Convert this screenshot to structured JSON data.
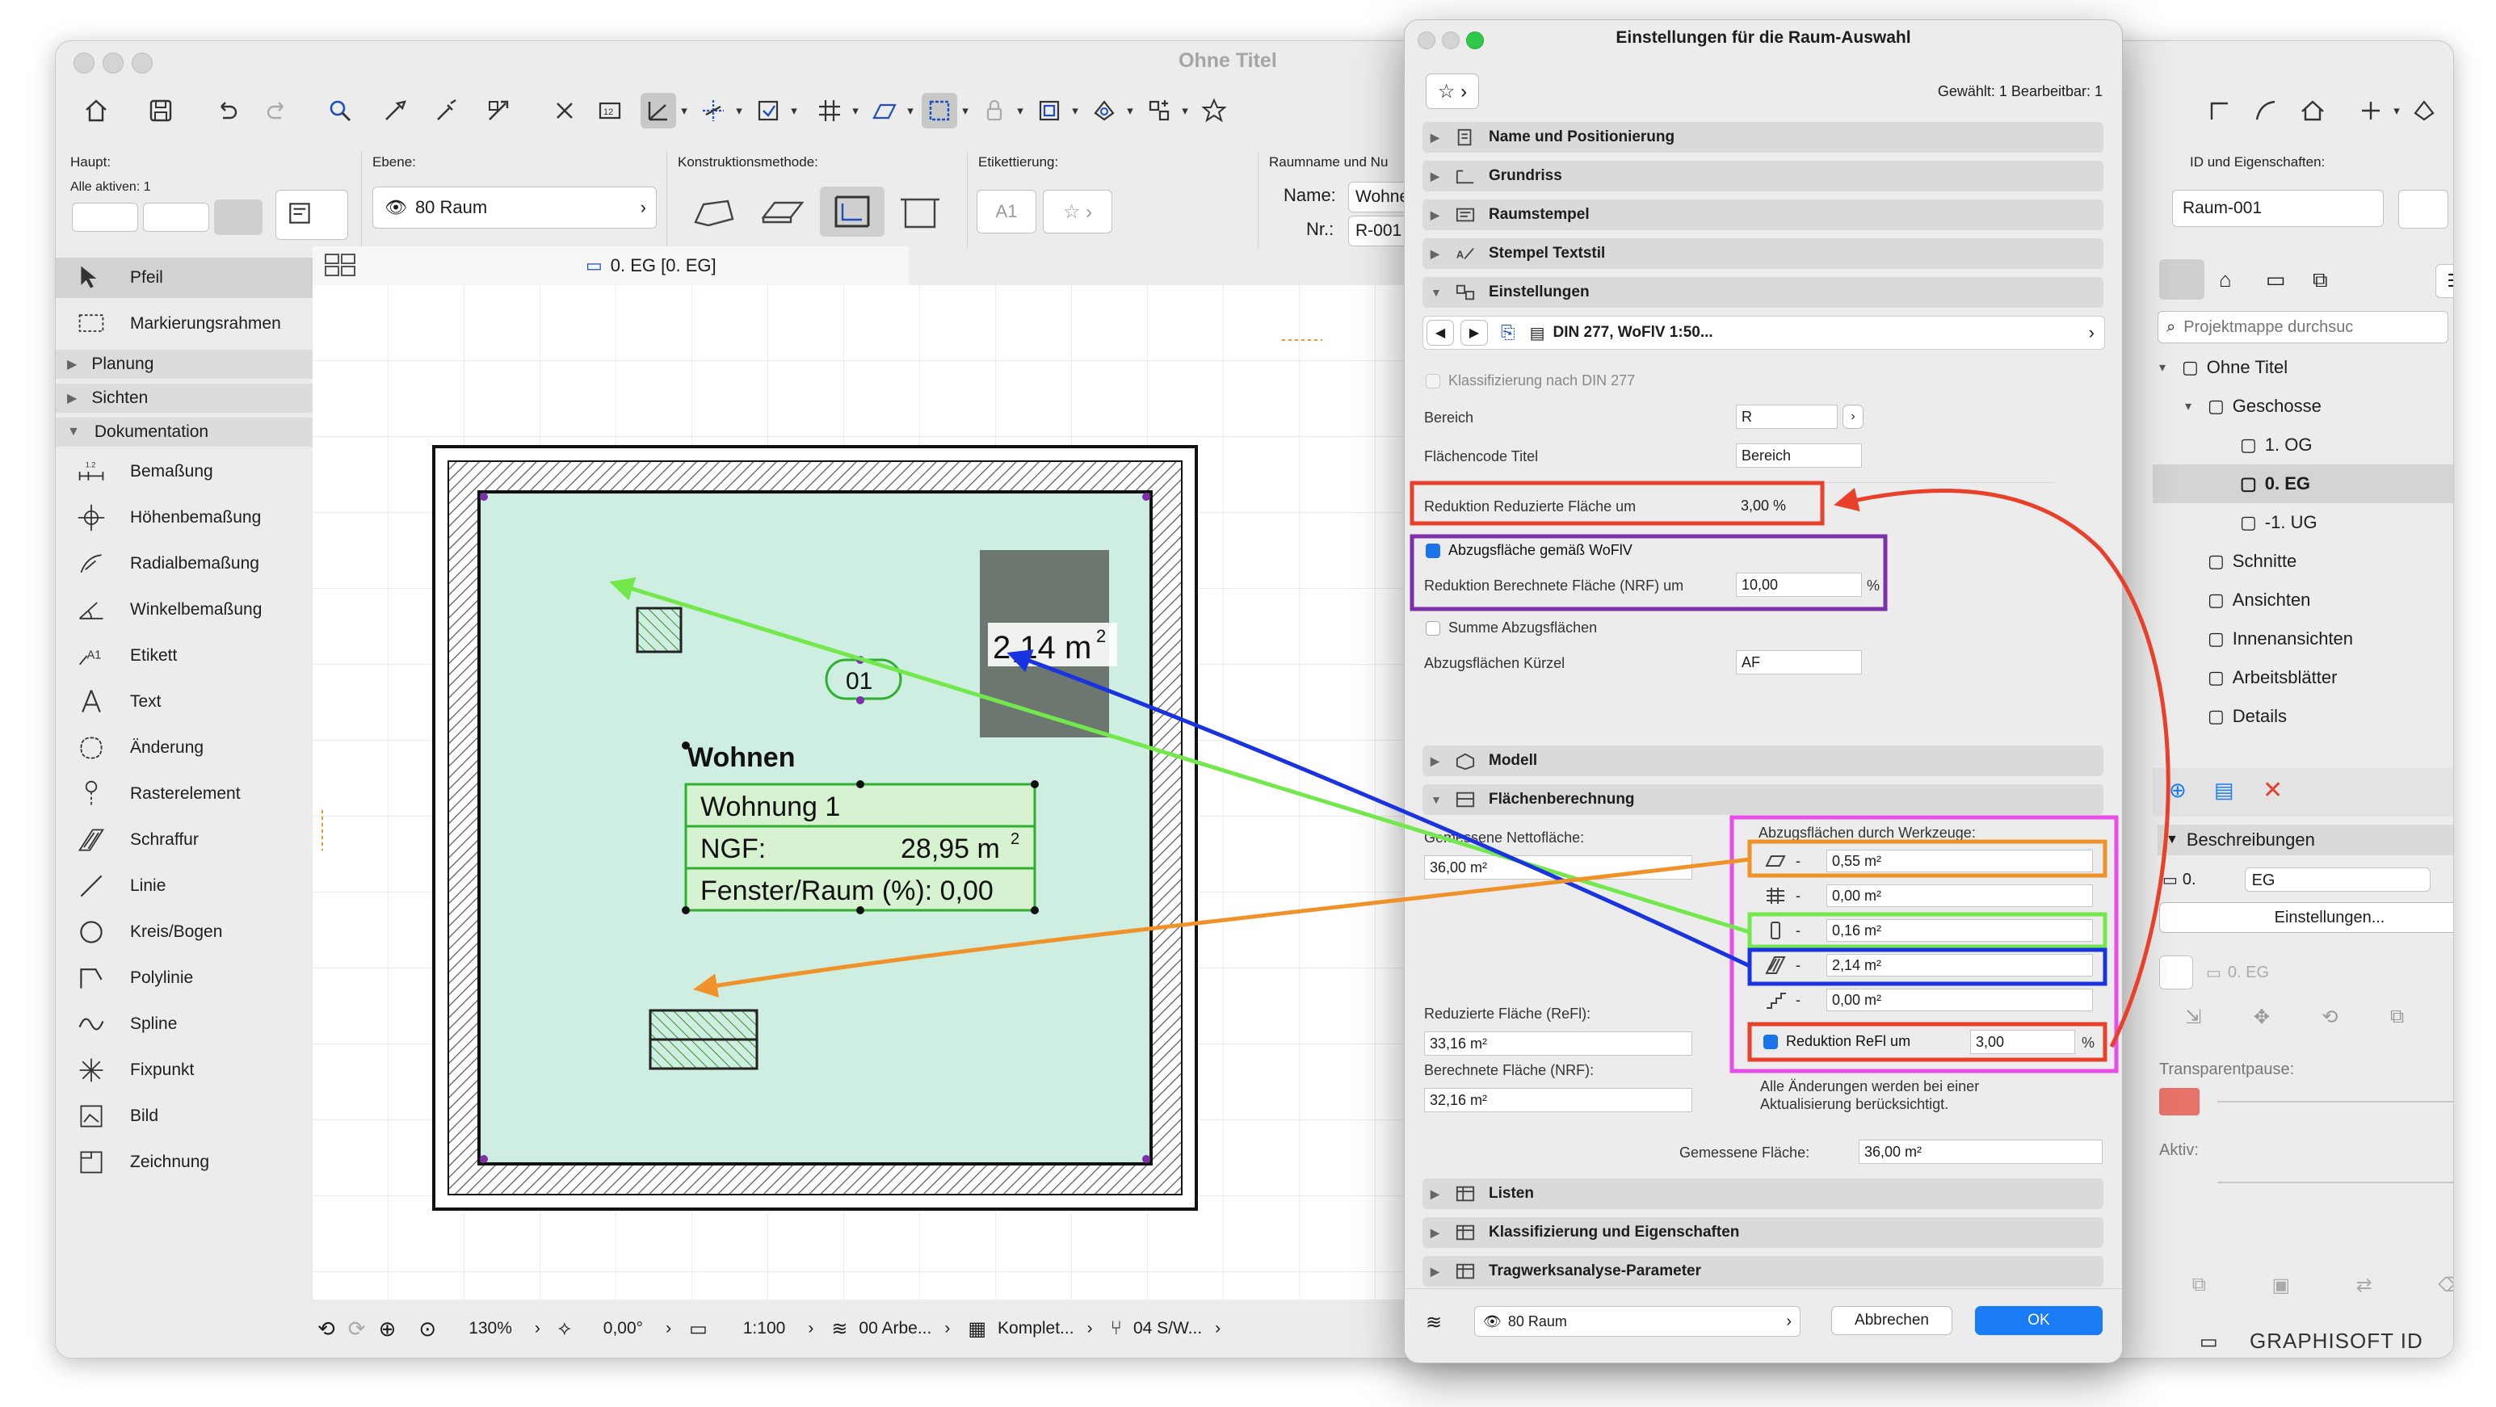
{
  "app": {
    "window_title": "Ohne Titel",
    "dialog_title": "Einstellungen für die Raum-Auswahl"
  },
  "toolbar": {
    "haupt_label": "Haupt:",
    "alle_aktiven": "Alle aktiven: 1",
    "ebene_label": "Ebene:",
    "ebene_value": "80 Raum",
    "konstruktion_label": "Konstruktionsmethode:",
    "etikett_label": "Etikettierung:",
    "etikett_a1": "A1",
    "raumname_label": "Raumname und Nu",
    "name_label": "Name:",
    "name_value": "Wohne",
    "nr_label": "Nr.:",
    "nr_value": "R-001",
    "id_label": "ID und Eigenschaften:",
    "id_value": "Raum-001"
  },
  "view_tab": {
    "label": "0. EG [0. EG]"
  },
  "toolbox": {
    "items_top": [
      {
        "label": "Pfeil"
      },
      {
        "label": "Markierungsrahmen"
      }
    ],
    "sections": [
      {
        "label": "Planung"
      },
      {
        "label": "Sichten"
      },
      {
        "label": "Dokumentation"
      }
    ],
    "doc_items": [
      {
        "label": "Bemaßung"
      },
      {
        "label": "Höhenbemaßung"
      },
      {
        "label": "Radialbemaßung"
      },
      {
        "label": "Winkelbemaßung"
      },
      {
        "label": "Etikett"
      },
      {
        "label": "Text"
      },
      {
        "label": "Änderung"
      },
      {
        "label": "Rasterelement"
      },
      {
        "label": "Schraffur"
      },
      {
        "label": "Linie"
      },
      {
        "label": "Kreis/Bogen"
      },
      {
        "label": "Polylinie"
      },
      {
        "label": "Spline"
      },
      {
        "label": "Fixpunkt"
      },
      {
        "label": "Bild"
      },
      {
        "label": "Zeichnung"
      }
    ]
  },
  "drawing": {
    "area_label": "2,14 m",
    "area_sup": "2",
    "marker": "01",
    "room_name": "Wohnen",
    "stamp_rows": [
      "Wohnung 1",
      "NGF:",
      "Fenster/Raum (%): 0,00"
    ],
    "ngf_value": "28,95 m",
    "ngf_sup": "2"
  },
  "statusbar": {
    "zoom": "130%",
    "angle": "0,00°",
    "scale": "1:100",
    "layer": "00 Arbe...",
    "model": "Komplet...",
    "pen": "04 S/W..."
  },
  "navigator": {
    "search_placeholder": "Projektmappe durchsuc",
    "tree": [
      {
        "label": "Ohne Titel",
        "level": 0
      },
      {
        "label": "Geschosse",
        "level": 1
      },
      {
        "label": "1. OG",
        "level": 2
      },
      {
        "label": "0. EG",
        "level": 2,
        "selected": true
      },
      {
        "label": "-1. UG",
        "level": 2
      },
      {
        "label": "Schnitte",
        "level": 1
      },
      {
        "label": "Ansichten",
        "level": 1
      },
      {
        "label": "Innenansichten",
        "level": 1
      },
      {
        "label": "Arbeitsblätter",
        "level": 1
      },
      {
        "label": "Details",
        "level": 1
      }
    ],
    "beschreibungen": "Beschreibungen",
    "geschoss_row_num": "0.",
    "geschoss_row_name": "EG",
    "einstellungen_btn": "Einstellungen...",
    "selected_view": "0. EG",
    "transparent_label": "Transparentpause:",
    "aktiv_label": "Aktiv:",
    "brand": "GRAPHISOFT ID"
  },
  "dialog": {
    "gewaehlt": "Gewählt: 1 Bearbeitbar: 1",
    "sections_top": [
      {
        "label": "Name und Positionierung",
        "open": false
      },
      {
        "label": "Grundriss",
        "open": false
      },
      {
        "label": "Raumstempel",
        "open": false
      },
      {
        "label": "Stempel Textstil",
        "open": false
      },
      {
        "label": "Einstellungen",
        "open": true
      }
    ],
    "din_value": "DIN 277, WoFlV 1:50...",
    "klassifizierung_label": "Klassifizierung nach DIN 277",
    "bereich_label": "Bereich",
    "bereich_value": "R",
    "flaechencode_label": "Flächencode Titel",
    "flaechencode_value": "Bereich",
    "reduktion_label": "Reduktion Reduzierte Fläche um",
    "reduktion_value": "3,00 %",
    "abzug_wofiv_label": "Abzugsfläche gemäß WoFlV",
    "red_nrf_label": "Reduktion Berechnete Fläche (NRF) um",
    "red_nrf_value": "10,00",
    "red_nrf_unit": "%",
    "summe_label": "Summe Abzugsflächen",
    "kuerzel_label": "Abzugsflächen Kürzel",
    "kuerzel_value": "AF",
    "modell_label": "Modell",
    "flaechenberechnung_label": "Flächenberechnung",
    "gemessene_netto_label": "Gemessene Nettofläche:",
    "gemessene_netto_value": "36,00 m²",
    "abzug_werkzeuge_label": "Abzugsflächen durch Werkzeuge:",
    "abzug_rows": [
      {
        "icon": "slab-icon",
        "value": "0,55 m²"
      },
      {
        "icon": "grid-icon",
        "value": "0,00 m²"
      },
      {
        "icon": "column-icon",
        "value": "0,16 m²"
      },
      {
        "icon": "fill-icon",
        "value": "2,14 m²"
      },
      {
        "icon": "stair-icon",
        "value": "0,00 m²"
      }
    ],
    "dash": "-",
    "reduktion_refl_label": "Reduktion ReFl um",
    "reduktion_refl_value": "3,00",
    "reduktion_refl_unit": "%",
    "reduzierte_label": "Reduzierte Fläche (ReFl):",
    "reduzierte_value": "33,16 m²",
    "berechnete_label": "Berechnete Fläche (NRF):",
    "berechnete_value": "32,16 m²",
    "hinweis_line1": "Alle Änderungen werden bei einer",
    "hinweis_line2": "Aktualisierung berücksichtigt.",
    "gemessene_flaeche_label": "Gemessene Fläche:",
    "gemessene_flaeche_value": "36,00 m²",
    "sections_bottom": [
      {
        "label": "Listen"
      },
      {
        "label": "Klassifizierung und Eigenschaften"
      },
      {
        "label": "Tragwerksanalyse-Parameter"
      }
    ],
    "layer_value": "80 Raum",
    "cancel_label": "Abbrechen",
    "ok_label": "OK"
  },
  "colors": {
    "red": "#e8402a",
    "purple": "#7b2fa8",
    "orange": "#f0922a",
    "green": "#72e84c",
    "blue": "#1a33e0",
    "magenta": "#e84de8",
    "room_fill": "#cdeee0",
    "accent": "#1a7cf5"
  }
}
